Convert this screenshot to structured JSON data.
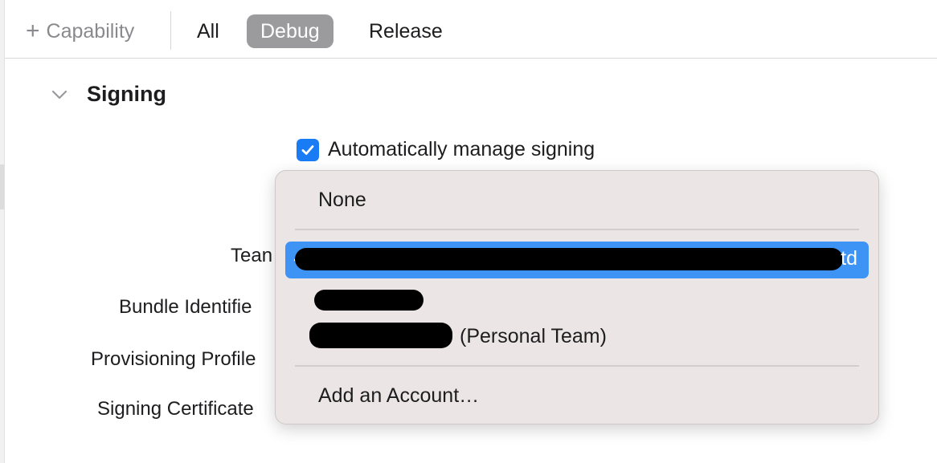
{
  "toolbar": {
    "capability_plus": "+",
    "capability_label": "Capability",
    "segments": [
      {
        "label": "All"
      },
      {
        "label": "Debug",
        "selected": true
      },
      {
        "label": "Release"
      }
    ]
  },
  "signing": {
    "section_title": "Signing",
    "auto_manage_label": "Automatically manage signing",
    "auto_manage_checked": true,
    "labels": {
      "team": "Tean",
      "bundle_identifier": "Bundle Identifie",
      "provisioning_profile": "Provisioning Profile",
      "signing_certificate": "Signing Certificate"
    }
  },
  "team_menu": {
    "none_label": "None",
    "selected_suffix": "td",
    "personal_team_suffix": "(Personal Team)",
    "add_account_label": "Add an Account…"
  },
  "colors": {
    "accent": "#3d94f5",
    "checkbox": "#1a7cf4",
    "segment_selected": "#9b9b9d",
    "menu_bg": "#ebe5e5"
  }
}
